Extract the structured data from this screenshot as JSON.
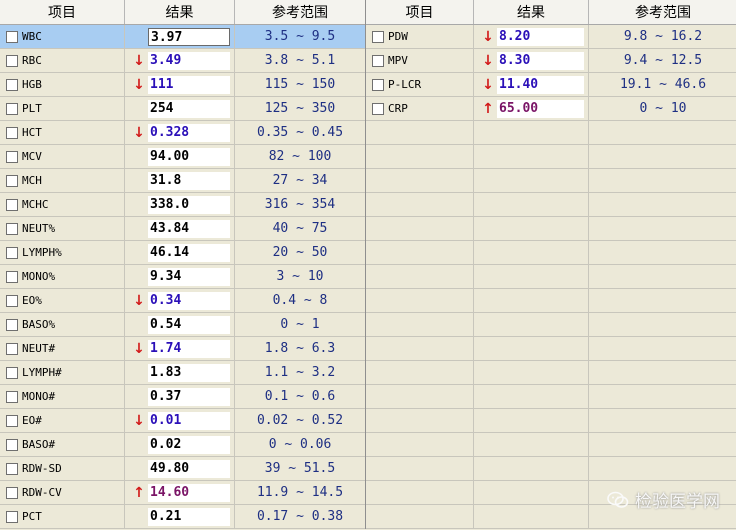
{
  "headers": {
    "item": "项目",
    "result": "结果",
    "reference": "参考范围"
  },
  "left_rows": [
    {
      "name": "WBC",
      "value": "3.97",
      "flag": "",
      "ref": "3.5 ~ 9.5",
      "selected": true
    },
    {
      "name": "RBC",
      "value": "3.49",
      "flag": "low",
      "ref": "3.8 ~ 5.1"
    },
    {
      "name": "HGB",
      "value": "111",
      "flag": "low",
      "ref": "115 ~ 150"
    },
    {
      "name": "PLT",
      "value": "254",
      "flag": "",
      "ref": "125 ~ 350"
    },
    {
      "name": "HCT",
      "value": "0.328",
      "flag": "low",
      "ref": "0.35 ~ 0.45"
    },
    {
      "name": "MCV",
      "value": "94.00",
      "flag": "",
      "ref": "82 ~ 100"
    },
    {
      "name": "MCH",
      "value": "31.8",
      "flag": "",
      "ref": "27 ~ 34"
    },
    {
      "name": "MCHC",
      "value": "338.0",
      "flag": "",
      "ref": "316 ~ 354"
    },
    {
      "name": "NEUT%",
      "value": "43.84",
      "flag": "",
      "ref": "40 ~ 75"
    },
    {
      "name": "LYMPH%",
      "value": "46.14",
      "flag": "",
      "ref": "20 ~ 50"
    },
    {
      "name": "MONO%",
      "value": "9.34",
      "flag": "",
      "ref": "3 ~ 10"
    },
    {
      "name": "EO%",
      "value": "0.34",
      "flag": "low",
      "ref": "0.4 ~ 8"
    },
    {
      "name": "BASO%",
      "value": "0.54",
      "flag": "",
      "ref": "0 ~ 1"
    },
    {
      "name": "NEUT#",
      "value": "1.74",
      "flag": "low",
      "ref": "1.8 ~ 6.3"
    },
    {
      "name": "LYMPH#",
      "value": "1.83",
      "flag": "",
      "ref": "1.1 ~ 3.2"
    },
    {
      "name": "MONO#",
      "value": "0.37",
      "flag": "",
      "ref": "0.1 ~ 0.6"
    },
    {
      "name": "EO#",
      "value": "0.01",
      "flag": "low",
      "ref": "0.02 ~ 0.52"
    },
    {
      "name": "BASO#",
      "value": "0.02",
      "flag": "",
      "ref": "0 ~ 0.06"
    },
    {
      "name": "RDW-SD",
      "value": "49.80",
      "flag": "",
      "ref": "39 ~ 51.5"
    },
    {
      "name": "RDW-CV",
      "value": "14.60",
      "flag": "high",
      "ref": "11.9 ~ 14.5"
    },
    {
      "name": "PCT",
      "value": "0.21",
      "flag": "",
      "ref": "0.17 ~ 0.38"
    }
  ],
  "right_rows": [
    {
      "name": "PDW",
      "value": "8.20",
      "flag": "low",
      "ref": "9.8 ~ 16.2"
    },
    {
      "name": "MPV",
      "value": "8.30",
      "flag": "low",
      "ref": "9.4 ~ 12.5"
    },
    {
      "name": "P-LCR",
      "value": "11.40",
      "flag": "low",
      "ref": "19.1 ~ 46.6"
    },
    {
      "name": "CRP",
      "value": "65.00",
      "flag": "high",
      "ref": "0 ~ 10"
    }
  ],
  "arrows": {
    "low": "↓",
    "high": "↑"
  },
  "watermark": {
    "text": "检验医学网",
    "icon": "wechat-icon"
  },
  "colors": {
    "low_value": "#2a0fb8",
    "high_value": "#7a1466",
    "arrow": "#d21a1a",
    "reference": "#1e2f83",
    "selected_row": "#a8cdf2"
  }
}
